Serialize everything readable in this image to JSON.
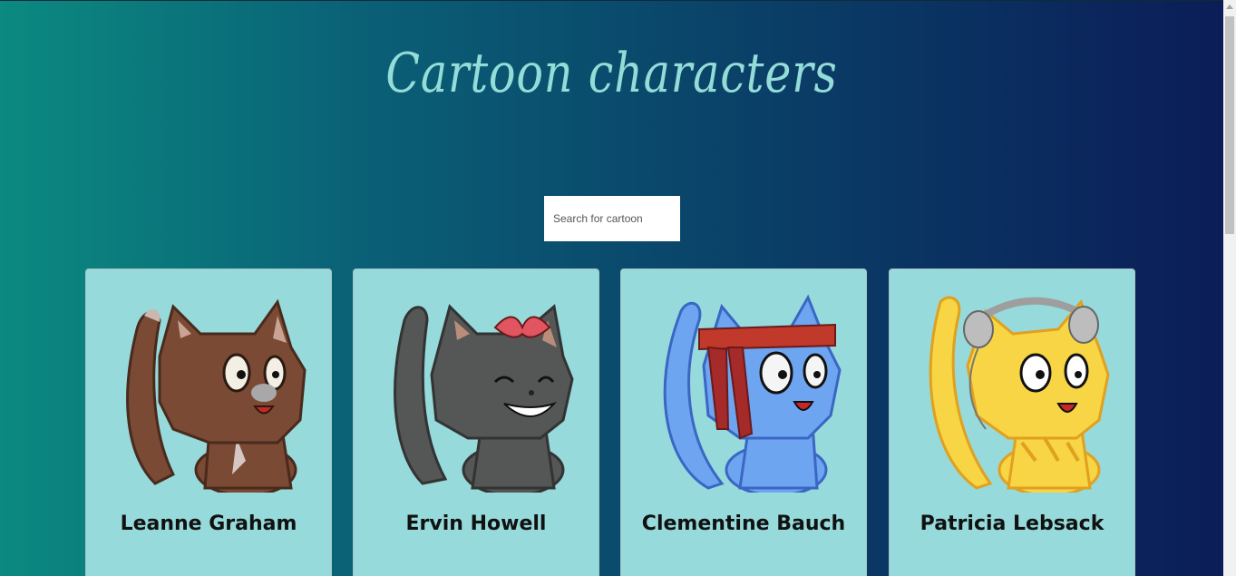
{
  "page": {
    "title": "Cartoon characters"
  },
  "search": {
    "placeholder": "Search for cartoon"
  },
  "cards": [
    {
      "name": "Leanne Graham",
      "image": "brown-cat-icon"
    },
    {
      "name": "Ervin Howell",
      "image": "gray-cat-bow-icon"
    },
    {
      "name": "Clementine Bauch",
      "image": "blue-cat-headband-icon"
    },
    {
      "name": "Patricia Lebsack",
      "image": "yellow-cat-headphones-icon"
    }
  ],
  "colors": {
    "card_bg": "#96dadb",
    "title": "#93dcd7"
  }
}
